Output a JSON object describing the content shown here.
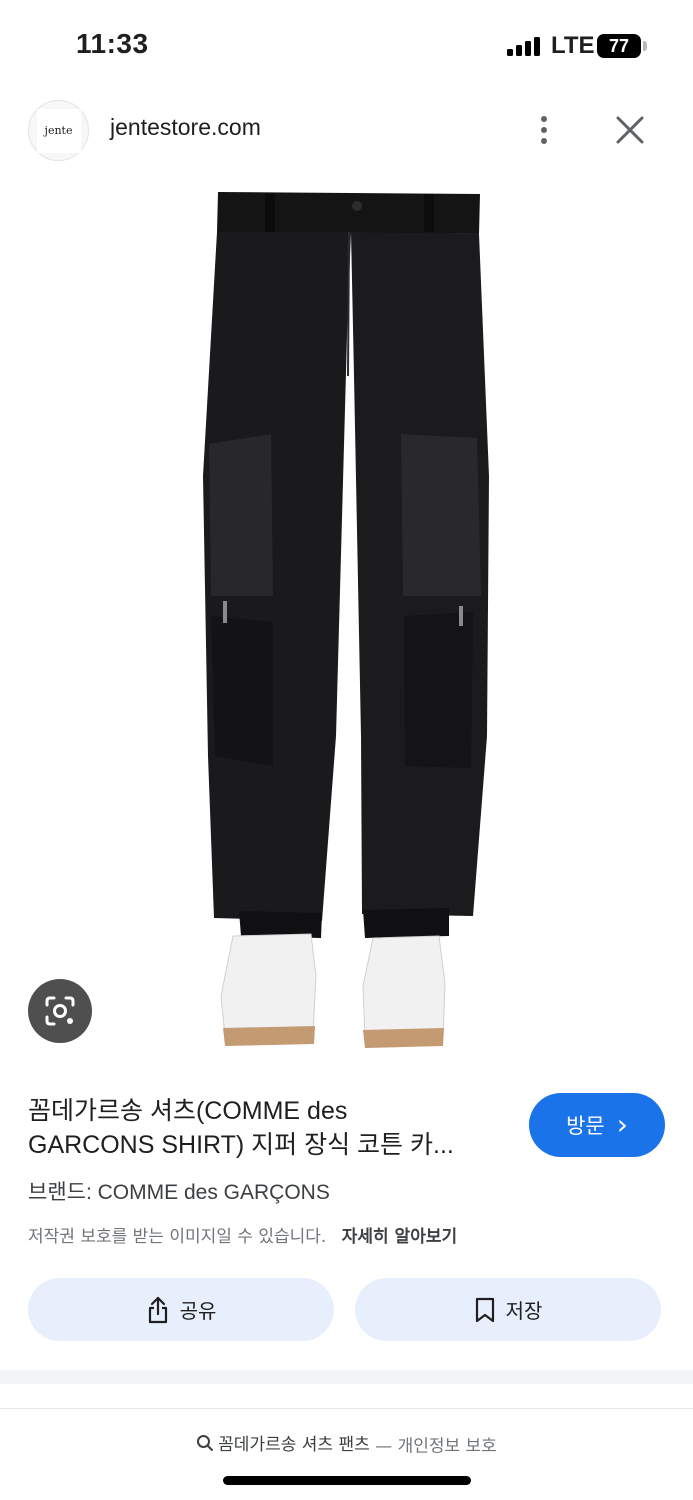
{
  "status_bar": {
    "time": "11:33",
    "network": "LTE",
    "battery": "77"
  },
  "header": {
    "logo_text": "jente",
    "domain": "jentestore.com"
  },
  "product": {
    "title_line1": "꼼데가르송 셔츠(COMME des",
    "title_line2": "GARCONS SHIRT) 지퍼 장식 코튼 카...",
    "brand": "브랜드: COMME des GARÇONS",
    "copyright_notice": "저작권 보호를 받는 이미지일 수 있습니다.",
    "learn_more": "자세히 알아보기"
  },
  "visit_button": {
    "label": "방문",
    "arrow": "›"
  },
  "actions": {
    "share_label": "공유",
    "save_label": "저장"
  },
  "footer": {
    "search_query": "꼼데가르송 셔츠 팬츠",
    "separator": "—",
    "privacy_label": "개인정보 보호"
  },
  "icons": [
    "signal-icon",
    "battery-icon",
    "more-vert-icon",
    "close-icon",
    "lens-icon",
    "share-icon",
    "bookmark-icon",
    "search-icon"
  ],
  "colors": {
    "accent": "#1a73e8",
    "action_bg": "#e8effc",
    "lens_bg": "#4f4f4f"
  }
}
